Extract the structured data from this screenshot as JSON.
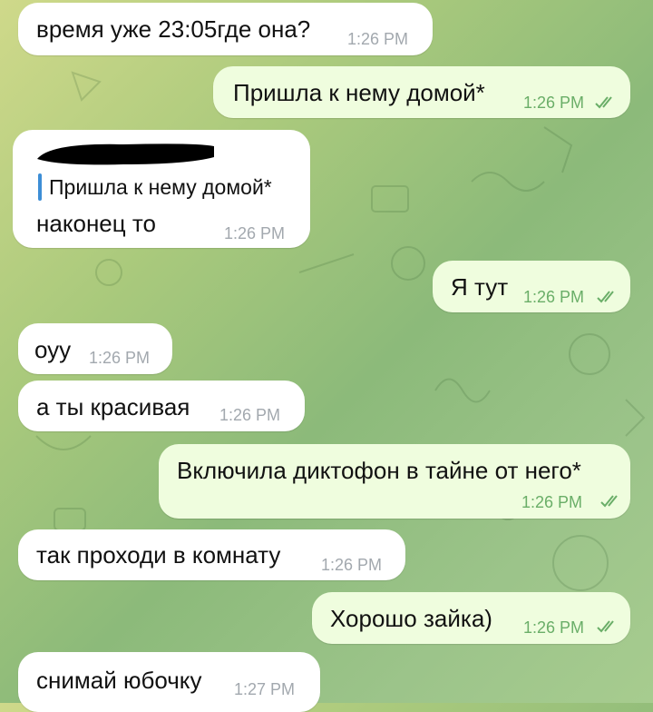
{
  "messages": [
    {
      "text": "время уже 23:05где она?",
      "time": "1:26 PM"
    },
    {
      "text": "Пришла к нему домой*",
      "time": "1:26 PM"
    },
    {
      "reply_quote": "Пришла к нему домой*",
      "text": "наконец то",
      "time": "1:26 PM"
    },
    {
      "text": "Я тут",
      "time": "1:26 PM"
    },
    {
      "text": "оуу",
      "time": "1:26 PM"
    },
    {
      "text": "а ты красивая",
      "time": "1:26 PM"
    },
    {
      "text": "Включила диктофон в тайне от него*",
      "time": "1:26 PM"
    },
    {
      "text": "так проходи в комнату",
      "time": "1:26 PM"
    },
    {
      "text": "Хорошо зайка)",
      "time": "1:26 PM"
    },
    {
      "text": "снимай юбочку",
      "time": "1:27 PM"
    }
  ],
  "colors": {
    "incoming_bubble": "#ffffff",
    "outgoing_bubble": "#effdde",
    "outgoing_time": "#6aae68",
    "incoming_time": "#a2a8ae",
    "reply_accent": "#3d8ed6"
  }
}
